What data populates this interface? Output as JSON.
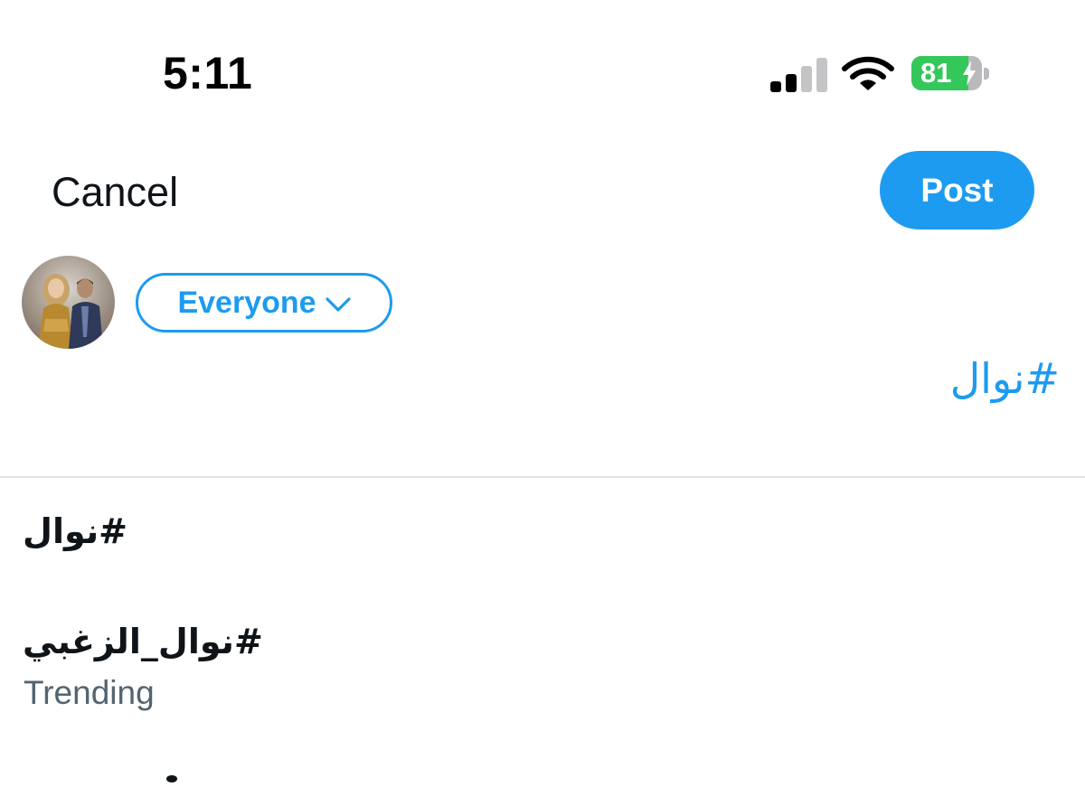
{
  "status_bar": {
    "time": "5:11",
    "signal_icon": "cellular-signal-icon",
    "wifi_icon": "wifi-icon",
    "battery_percent": 81,
    "battery_label": "81",
    "battery_charging": true
  },
  "nav": {
    "cancel_label": "Cancel",
    "post_label": "Post"
  },
  "composer": {
    "avatar_icon": "user-avatar",
    "audience_label": "Everyone",
    "audience_icon": "chevron-down-icon",
    "text": "#نوال"
  },
  "suggestions": [
    {
      "label": "#نوال",
      "subtitle": ""
    },
    {
      "label": "#نوال_الزغبي",
      "subtitle": "Trending"
    }
  ],
  "colors": {
    "accent": "#1d9bf0",
    "text": "#0f1419",
    "secondary_text": "#536471",
    "battery_green": "#34c759",
    "divider": "#e1e4e7"
  }
}
